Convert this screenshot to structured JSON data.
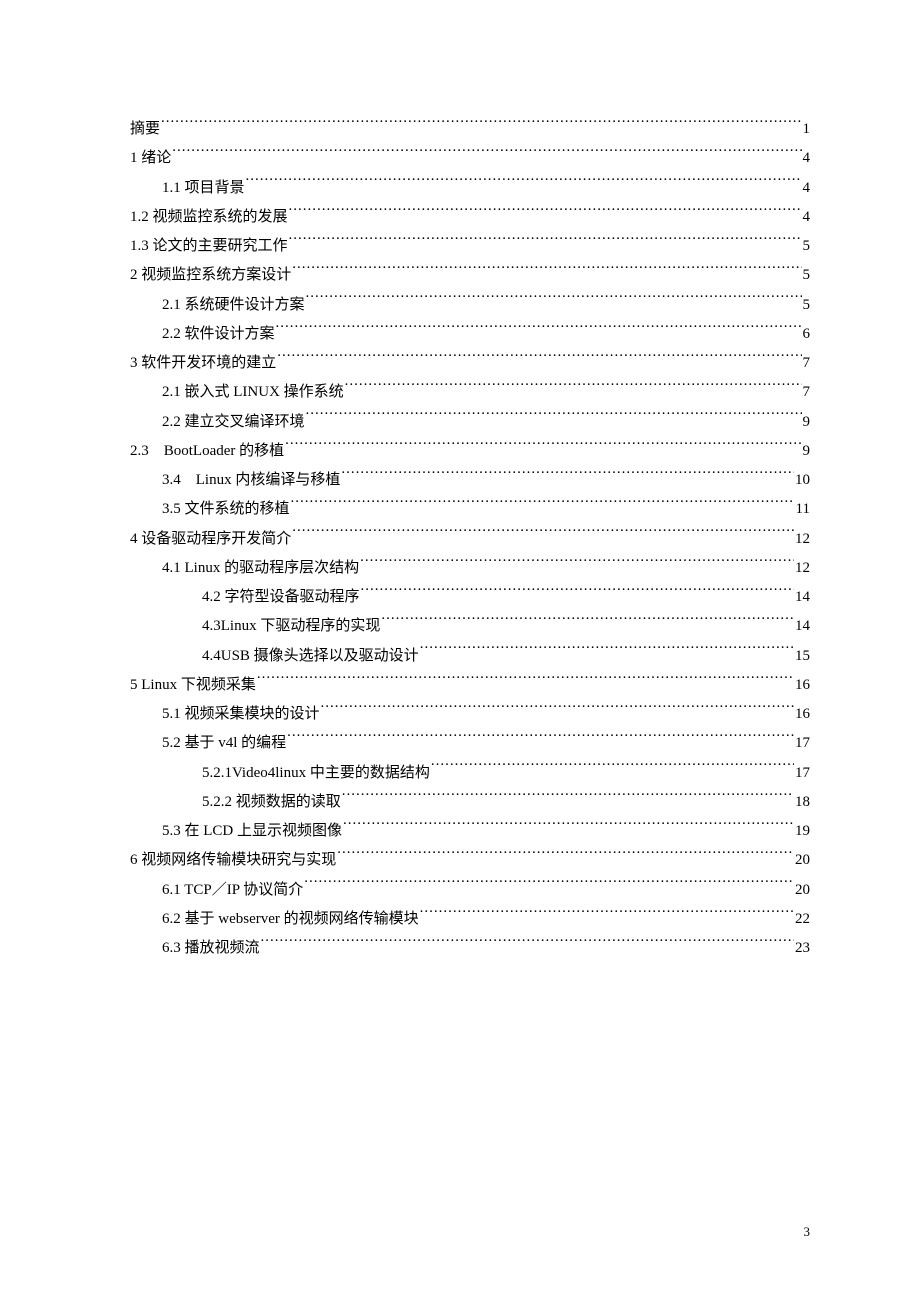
{
  "toc": [
    {
      "title": "摘要",
      "page": "1",
      "indent": 0
    },
    {
      "title": "1 绪论",
      "page": "4",
      "indent": 0
    },
    {
      "title": "1.1 项目背景",
      "page": "4",
      "indent": 1
    },
    {
      "title": "1.2 视频监控系统的发展",
      "page": "4",
      "indent": 0
    },
    {
      "title": "1.3 论文的主要研究工作",
      "page": "5",
      "indent": 0
    },
    {
      "title": "2 视频监控系统方案设计",
      "page": "5",
      "indent": 0
    },
    {
      "title": "2.1 系统硬件设计方案",
      "page": "5",
      "indent": 1
    },
    {
      "title": "2.2 软件设计方案",
      "page": "6",
      "indent": 1
    },
    {
      "title": "3 软件开发环境的建立",
      "page": "7",
      "indent": 0
    },
    {
      "title": "2.1 嵌入式 LINUX 操作系统",
      "page": "7",
      "indent": 1
    },
    {
      "title": "2.2 建立交叉编译环境",
      "page": "9",
      "indent": 1
    },
    {
      "title": "2.3 BootLoader 的移植",
      "page": "9",
      "indent": 0
    },
    {
      "title": "3.4 Linux 内核编译与移植",
      "page": "10",
      "indent": 1
    },
    {
      "title": "3.5 文件系统的移植",
      "page": "11",
      "indent": 1
    },
    {
      "title": "4 设备驱动程序开发简介",
      "page": "12",
      "indent": 0
    },
    {
      "title": "4.1 Linux 的驱动程序层次结构",
      "page": "12",
      "indent": 1
    },
    {
      "title": "4.2 字符型设备驱动程序",
      "page": "14",
      "indent": 2
    },
    {
      "title": "4.3Linux 下驱动程序的实现",
      "page": "14",
      "indent": 2
    },
    {
      "title": "4.4USB 摄像头选择以及驱动设计",
      "page": "15",
      "indent": 2
    },
    {
      "title": "5 Linux 下视频采集",
      "page": "16",
      "indent": 0
    },
    {
      "title": "5.1 视频采集模块的设计",
      "page": "16",
      "indent": 1
    },
    {
      "title": "5.2 基于 v4l 的编程",
      "page": "17",
      "indent": 1
    },
    {
      "title": "5.2.1Video4linux 中主要的数据结构",
      "page": "17",
      "indent": 2
    },
    {
      "title": "5.2.2 视频数据的读取",
      "page": "18",
      "indent": 2
    },
    {
      "title": "5.3 在 LCD 上显示视频图像",
      "page": "19",
      "indent": 1
    },
    {
      "title": "6 视频网络传输模块研究与实现",
      "page": "20",
      "indent": 0
    },
    {
      "title": "6.1 TCP／IP 协议简介",
      "page": "20",
      "indent": 1
    },
    {
      "title": "6.2 基于 webserver 的视频网络传输模块",
      "page": "22",
      "indent": 1
    },
    {
      "title": "6.3 播放视频流",
      "page": "23",
      "indent": 1
    }
  ],
  "footer_page": "3"
}
